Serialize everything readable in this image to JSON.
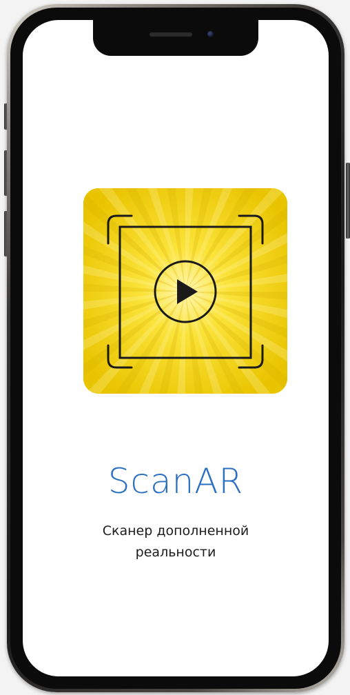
{
  "app": {
    "name": "ScanAR",
    "tagline": "Сканер дополненной реальности",
    "icon": "ar-scan-play-icon"
  },
  "colors": {
    "title": "#2b6fc2",
    "icon_background": "#f2d400",
    "text": "#1b1b1b"
  }
}
